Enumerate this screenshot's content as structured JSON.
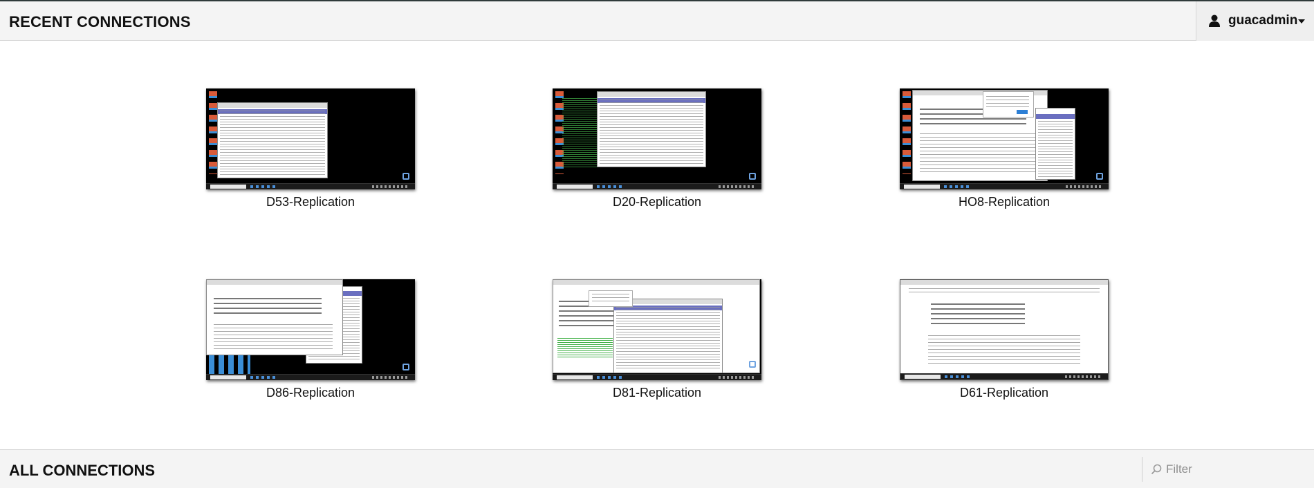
{
  "header": {
    "title": "RECENT CONNECTIONS",
    "user_name": "guacadmin",
    "user_icon": "user-icon",
    "menu_icon": "caret-down-icon"
  },
  "recent_connections": [
    {
      "name": "D53-Replication"
    },
    {
      "name": "D20-Replication"
    },
    {
      "name": "HO8-Replication"
    },
    {
      "name": "D86-Replication"
    },
    {
      "name": "D81-Replication"
    },
    {
      "name": "D61-Replication"
    }
  ],
  "footer": {
    "title": "ALL CONNECTIONS",
    "filter_placeholder": "Filter",
    "filter_icon": "search-icon"
  },
  "colors": {
    "header_bg": "#f4f4f4",
    "top_rule": "#2f3a3a",
    "border": "#d6d6d6"
  }
}
